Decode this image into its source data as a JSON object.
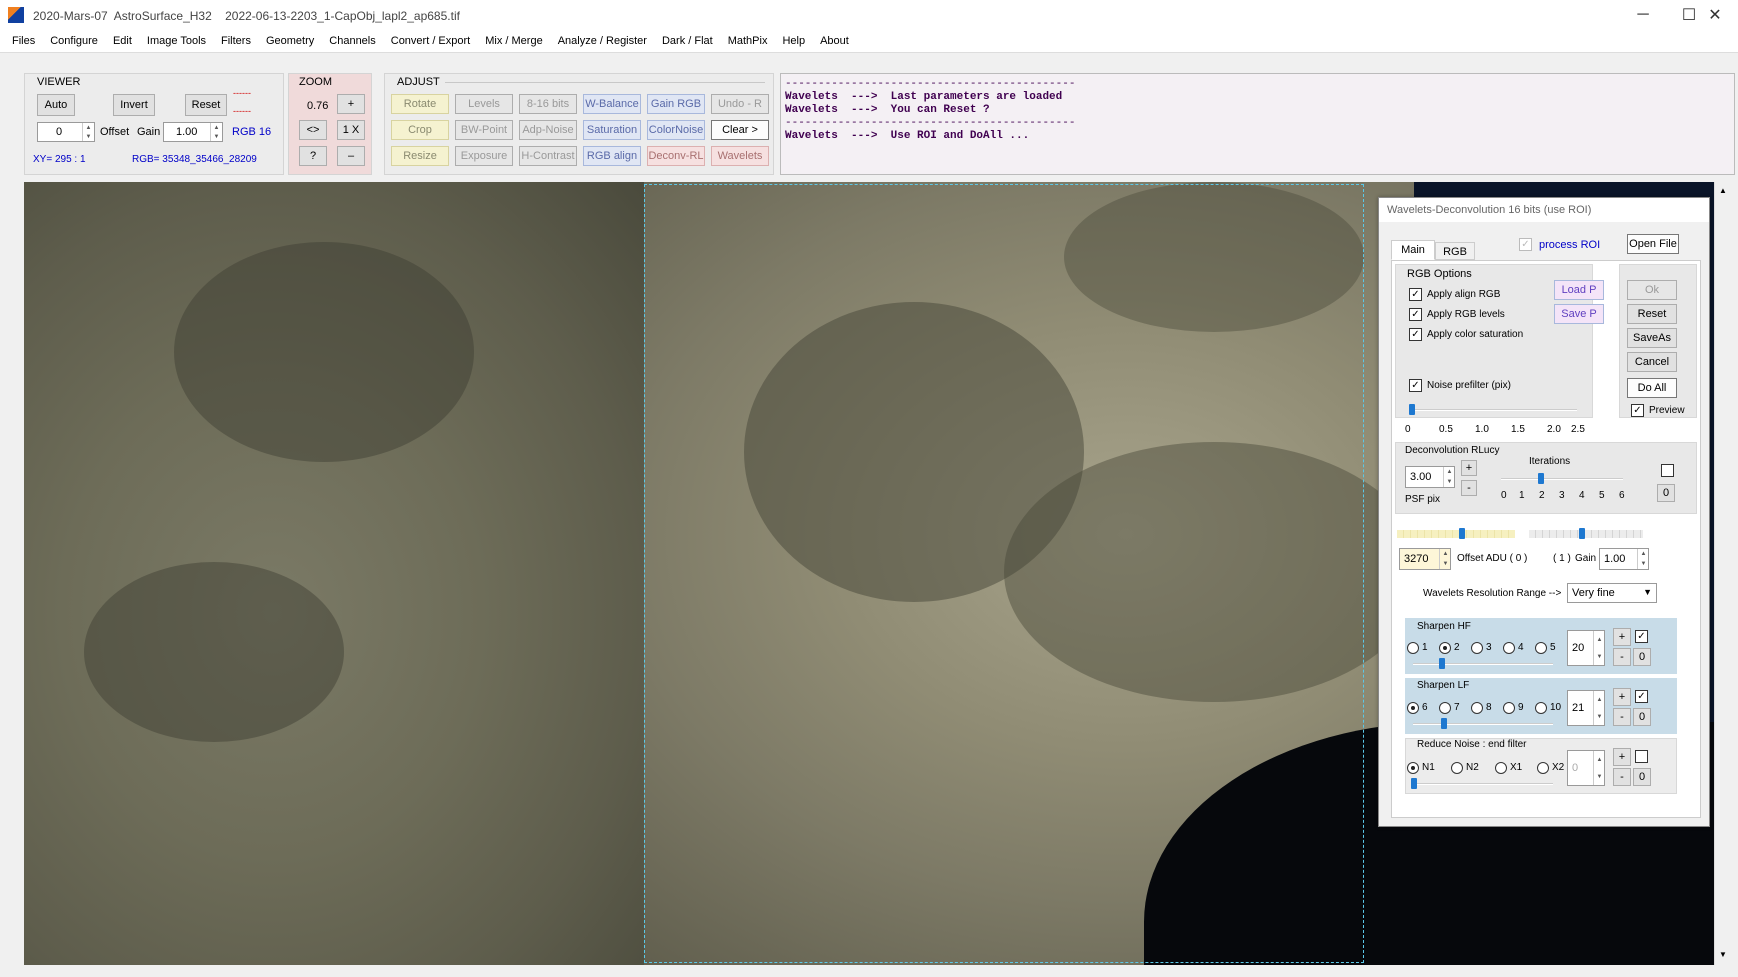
{
  "window": {
    "title": "2020-Mars-07  AstroSurface_H32    2022-06-13-2203_1-CapObj_lapl2_ap685.tif",
    "controls": [
      "─",
      "☐",
      "✕"
    ]
  },
  "menu": [
    "Files",
    "Configure",
    "Edit",
    "Image Tools",
    "Filters",
    "Geometry",
    "Channels",
    "Convert / Export",
    "Mix / Merge",
    "Analyze / Register",
    "Dark / Flat",
    "MathPix",
    "Help",
    "About"
  ],
  "viewer": {
    "label": "VIEWER",
    "auto": "Auto",
    "invert": "Invert",
    "reset": "Reset",
    "offset_value": "0",
    "offset_label": "Offset",
    "gain_label": "Gain",
    "gain_value": "1.00",
    "rgb_mode": "RGB 16",
    "red1": "------",
    "red2": "------",
    "xy": "XY=  295 : 1",
    "rgb": "RGB=  35348_35466_28209"
  },
  "zoom": {
    "label": "ZOOM",
    "value": "0.76",
    "plus": "+",
    "fit": "<>",
    "onex": "1 X",
    "help": "?",
    "minus": "–"
  },
  "adjust": {
    "label": "ADJUST",
    "buttons": [
      "Rotate",
      "Levels",
      "8-16 bits",
      "W-Balance",
      "Gain RGB",
      "Undo - R",
      "Crop",
      "BW-Point",
      "Adp-Noise",
      "Saturation",
      "ColorNoise",
      "Clear >",
      "Resize",
      "Exposure",
      "H-Contrast",
      "RGB align",
      "Deconv-RL",
      "Wavelets"
    ]
  },
  "messages": {
    "sep1": "--------------------------------------------",
    "l1": "Wavelets  --->  Last parameters are loaded",
    "l2": "Wavelets  --->  You can Reset ?",
    "sep2": "--------------------------------------------",
    "l3": "Wavelets  --->  Use ROI and DoAll ..."
  },
  "dialog": {
    "title": "Wavelets-Deconvolution 16 bits (use ROI)",
    "tab_main": "Main",
    "tab_rgb": "RGB",
    "process_roi": "process ROI",
    "open_file": "Open File",
    "rgb_options": "RGB Options",
    "apply_align": "Apply align RGB",
    "apply_levels": "Apply RGB levels",
    "apply_sat": "Apply color saturation",
    "load_p": "Load P",
    "save_p": "Save P",
    "ok": "Ok",
    "reset": "Reset",
    "saveas": "SaveAs",
    "cancel": "Cancel",
    "doall": "Do All",
    "preview": "Preview",
    "noise_prefilter": "Noise prefilter (pix)",
    "noise_ticks": [
      "0",
      "0.5",
      "1.0",
      "1.5",
      "2.0",
      "2.5"
    ],
    "noise_value": 0,
    "deconv_label": "Deconvolution RLucy",
    "iterations": "Iterations",
    "psf_value": "3.00",
    "psf_label": "PSF pix",
    "iter_ticks": [
      "0",
      "1",
      "2",
      "3",
      "4",
      "5",
      "6"
    ],
    "iter_value": 2,
    "iter_field": "0",
    "offset_value": "3270",
    "offset_label": "Offset ADU ( 0 )",
    "one": "( 1 )",
    "gain_label": "Gain",
    "gain_value": "1.00",
    "range_label": "Wavelets Resolution Range  -->",
    "range_value": "Very fine",
    "hf_label": "Sharpen HF",
    "hf_options": [
      "1",
      "2",
      "3",
      "4",
      "5"
    ],
    "hf_selected": "2",
    "hf_value": "20",
    "hf_checked": true,
    "lf_label": "Sharpen LF",
    "lf_options": [
      "6",
      "7",
      "8",
      "9",
      "10"
    ],
    "lf_selected": "6",
    "lf_value": "21",
    "lf_checked": true,
    "rn_label": "Reduce Noise : end filter",
    "rn_options": [
      "N1",
      "N2",
      "X1",
      "X2"
    ],
    "rn_selected": "N1",
    "rn_value": "0",
    "rn_checked": false,
    "plus": "+",
    "minus": "-",
    "zero": "0"
  },
  "colors": {
    "accent_blue": "#1e78d0",
    "label_blue": "#0000c8",
    "msg_text": "#400050",
    "roi": "#5ac8e8"
  }
}
